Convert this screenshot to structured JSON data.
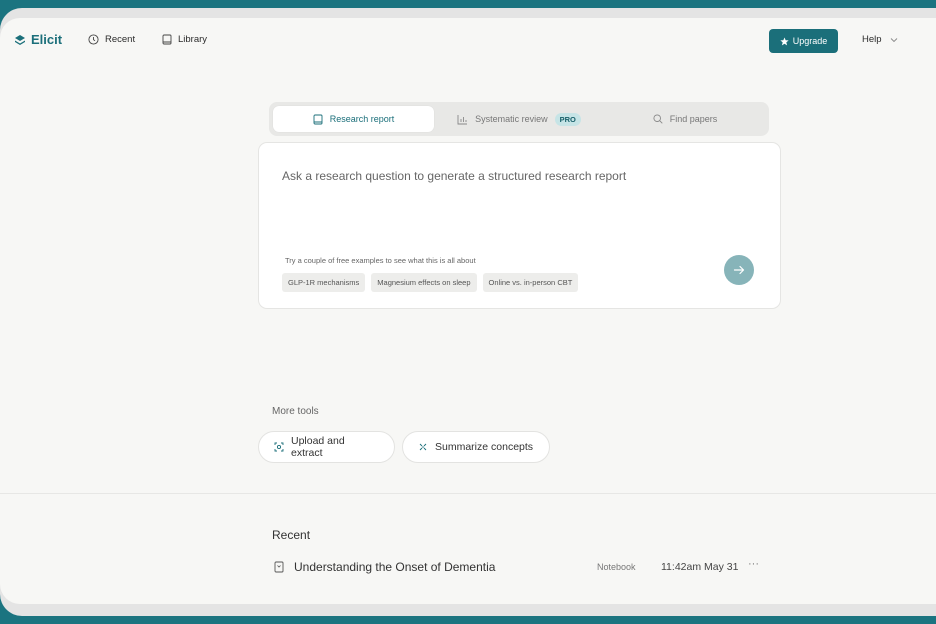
{
  "nav": {
    "logo": "Elicit",
    "recent": "Recent",
    "library": "Library",
    "upgrade": "Upgrade",
    "help": "Help"
  },
  "tabs": [
    {
      "label": "Research report",
      "icon": "book-icon",
      "active": true
    },
    {
      "label": "Systematic review",
      "icon": "chart-icon",
      "badge": "PRO"
    },
    {
      "label": "Find papers",
      "icon": "search-icon"
    }
  ],
  "input": {
    "placeholder": "Ask a research question to generate a structured research report",
    "examples_hint": "Try a couple of free examples to see what this is all about",
    "examples": [
      "GLP-1R mechanisms",
      "Magnesium effects on sleep",
      "Online vs. in-person CBT"
    ]
  },
  "more_tools": {
    "label": "More tools",
    "tools": [
      {
        "label": "Upload and extract",
        "icon": "scan-icon"
      },
      {
        "label": "Summarize concepts",
        "icon": "sparkle-icon"
      }
    ]
  },
  "recent": {
    "heading": "Recent",
    "items": [
      {
        "title": "Understanding the Onset of Dementia",
        "type": "Notebook",
        "time": "11:42am May 31",
        "more": "···"
      }
    ]
  },
  "colors": {
    "accent": "#1b6f7a",
    "background": "#f7f7f5",
    "frame": "#1b7480"
  }
}
